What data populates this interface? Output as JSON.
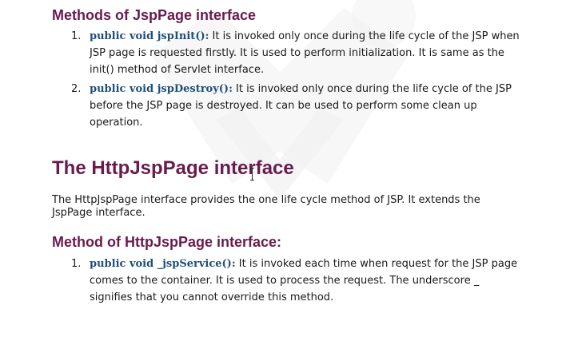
{
  "section1": {
    "heading": "Methods of JspPage interface",
    "items": [
      {
        "number": "1.",
        "method": "public void jspInit():",
        "text": " It is invoked only once during the life cycle of the JSP when JSP page is requested firstly. It is used to perform initialization. It is same as the init() method of Servlet interface."
      },
      {
        "number": "2.",
        "method": "public void jspDestroy():",
        "text": " It is invoked only once during the life cycle of the JSP before the JSP page is destroyed. It can be used to perform some clean up operation."
      }
    ]
  },
  "section2": {
    "heading": "The HttpJspPage interface",
    "paragraph": "The HttpJspPage interface provides the one life cycle method of JSP. It extends the JspPage interface."
  },
  "section3": {
    "heading": "Method of HttpJspPage interface:",
    "items": [
      {
        "number": "1.",
        "method": "public void _jspService():",
        "text": " It is invoked each time when request for the JSP page comes to the container. It is used to process the request. The underscore _ signifies that you cannot override this method."
      }
    ]
  },
  "colors": {
    "heading": "#6a1b4d",
    "method": "#1f4e79",
    "body_text": "#1a1a1a"
  }
}
